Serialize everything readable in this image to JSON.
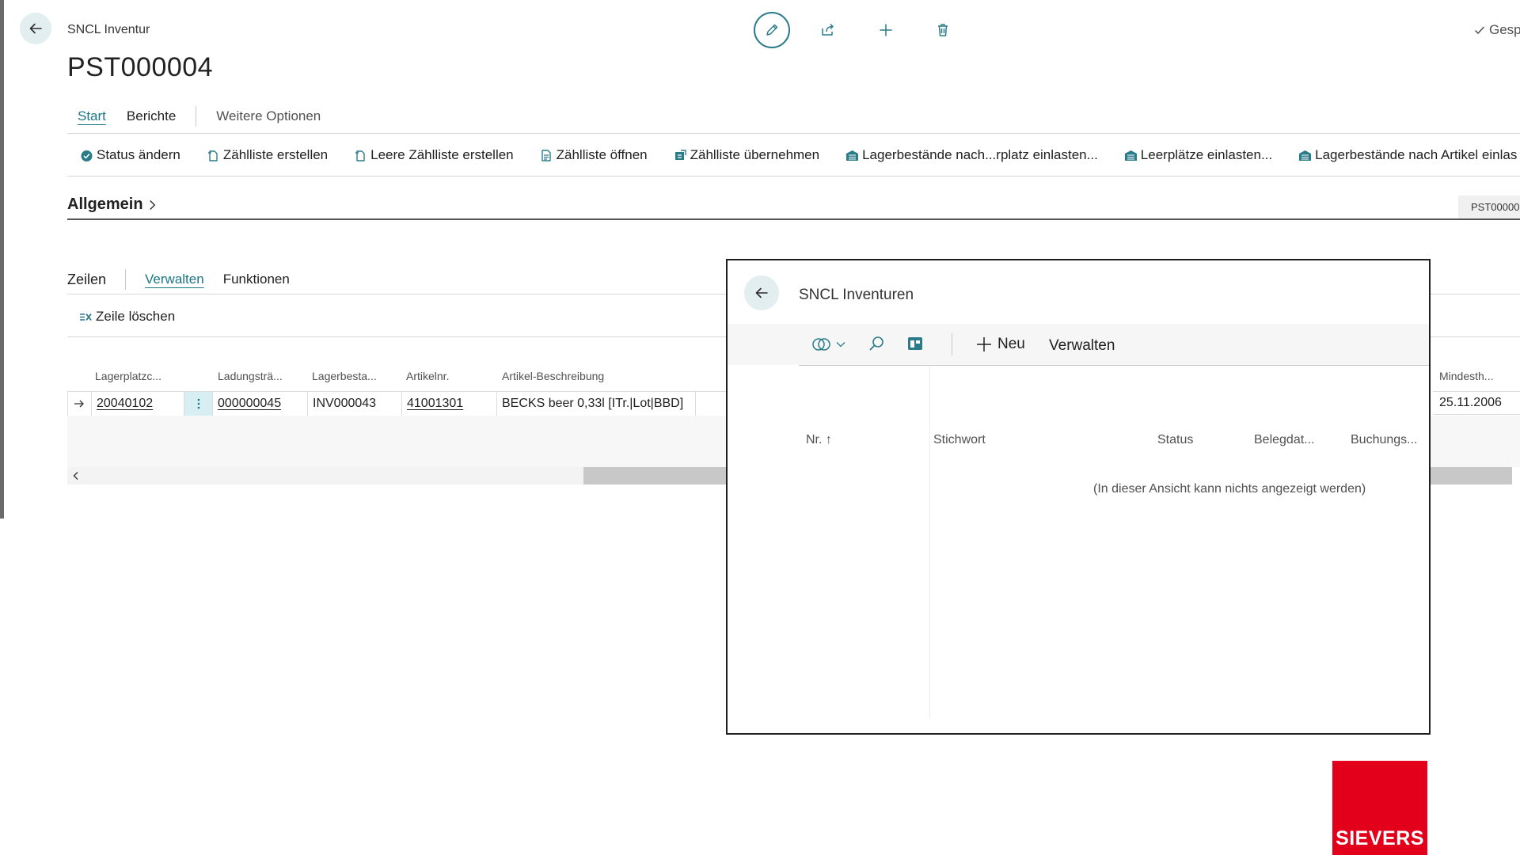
{
  "header": {
    "app_title": "SNCL Inventur",
    "doc_title": "PST000004",
    "saved_label": "Gesp"
  },
  "icons": {
    "back": "arrow-left-icon",
    "edit": "pencil-icon",
    "share": "share-icon",
    "new": "plus-icon",
    "delete": "trash-icon",
    "saved": "checkmark-icon"
  },
  "nav_tabs": [
    "Start",
    "Berichte",
    "Weitere Optionen"
  ],
  "actions": [
    "Status ändern",
    "Zählliste erstellen",
    "Leere Zählliste erstellen",
    "Zählliste öffnen",
    "Zählliste übernehmen",
    "Lagerbestände nach...rplatz einlasten...",
    "Leerplätze einlasten...",
    "Lagerbestände nach Artikel einlas"
  ],
  "general": {
    "title": "Allgemein",
    "pill": "PST00000"
  },
  "lines": {
    "tabs": [
      "Zeilen",
      "Verwalten",
      "Funktionen"
    ],
    "delete_label": "Zeile löschen",
    "columns": [
      "Lagerplatzc...",
      "Ladungsträ...",
      "Lagerbesta...",
      "Artikelnr.",
      "Artikel-Beschreibung",
      "Mindesth..."
    ],
    "row": {
      "lagerplatz": "20040102",
      "ladung": "000000045",
      "lagerbestand": "INV000043",
      "artikelnr": "41001301",
      "beschreibung": "BECKS beer 0,33l [ITr.|Lot|BBD]",
      "mindesthalt": "25.11.2006"
    }
  },
  "dialog": {
    "title": "SNCL Inventuren",
    "new_label": "Neu",
    "manage_label": "Verwalten",
    "columns": [
      "Nr. ↑",
      "Stichwort",
      "Status",
      "Belegdat...",
      "Buchungs..."
    ],
    "empty_text": "(In dieser Ansicht kann nichts angezeigt werden)"
  },
  "logo": {
    "text": "SIEVERS",
    "color": "#e2001a"
  },
  "colors": {
    "accent": "#1b7685",
    "back_bg": "#e2eef0"
  }
}
